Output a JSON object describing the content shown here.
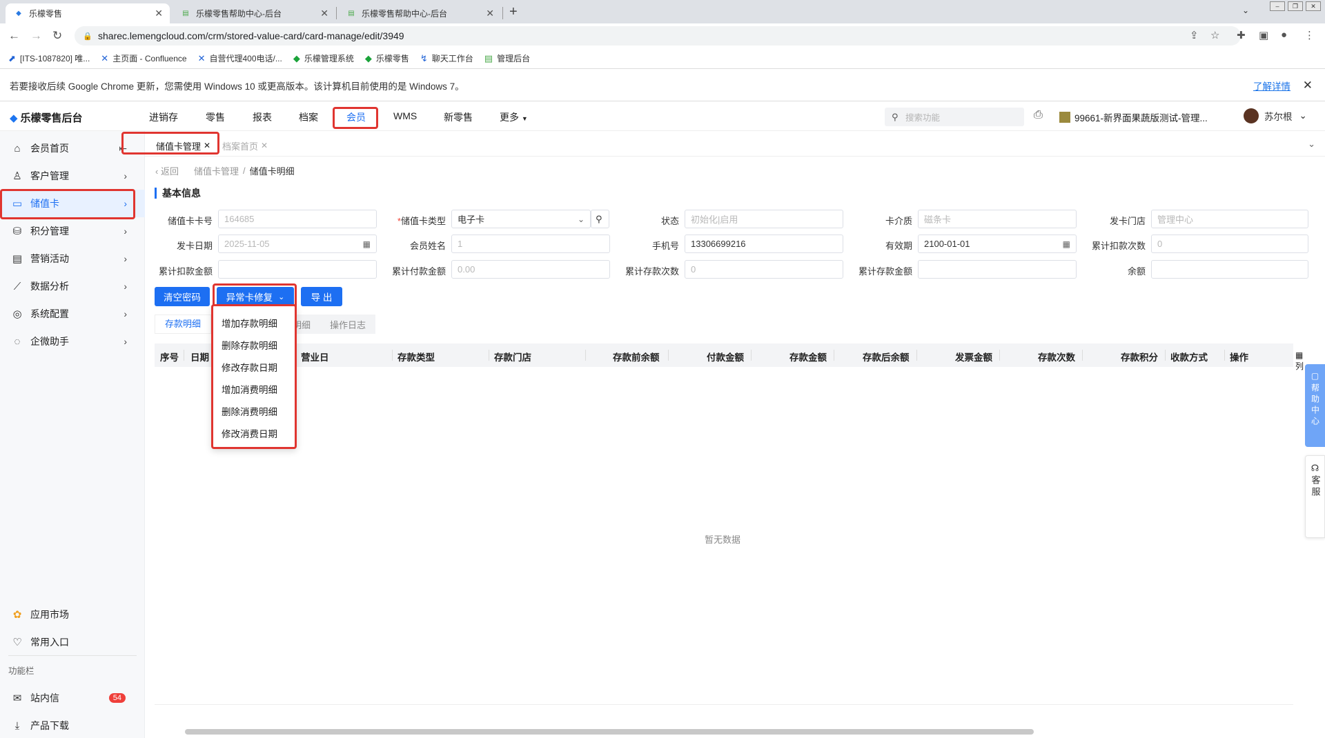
{
  "browser": {
    "tabs": [
      {
        "label": "乐檬零售"
      },
      {
        "label": "乐檬零售帮助中心-后台"
      },
      {
        "label": "乐檬零售帮助中心-后台"
      }
    ],
    "url": "sharec.lemengcloud.com/crm/stored-value-card/card-manage/edit/3949",
    "bookmarks": [
      "[ITS-1087820] 唯...",
      "主页面 - Confluence",
      "自营代理400电话/...",
      "乐檬管理系统",
      "乐檬零售",
      "聊天工作台",
      "管理后台"
    ],
    "infobar_text": "若要接收后续 Google Chrome 更新，您需使用 Windows 10 或更高版本。该计算机目前使用的是 Windows 7。",
    "infobar_link": "了解详情"
  },
  "app": {
    "logo": "乐檬零售后台",
    "menu": [
      "进销存",
      "零售",
      "报表",
      "档案",
      "会员",
      "WMS",
      "新零售",
      "更多"
    ],
    "search_placeholder": "搜索功能",
    "store": "99661-新界面果蔬版测试-管理...",
    "user": "苏尔根"
  },
  "sidebar": {
    "items": [
      {
        "label": "会员首页",
        "icon": "home-icon"
      },
      {
        "label": "客户管理",
        "icon": "user-icon"
      },
      {
        "label": "储值卡",
        "icon": "card-icon"
      },
      {
        "label": "积分管理",
        "icon": "coins-icon"
      },
      {
        "label": "营销活动",
        "icon": "calendar-icon"
      },
      {
        "label": "数据分析",
        "icon": "chart-icon"
      },
      {
        "label": "系统配置",
        "icon": "settings-icon"
      },
      {
        "label": "企微助手",
        "icon": "chat-icon"
      }
    ],
    "bottom": [
      {
        "label": "应用市场"
      },
      {
        "label": "常用入口"
      }
    ],
    "section_title": "功能栏",
    "inbox": "站内信",
    "inbox_count": "54",
    "download": "产品下载"
  },
  "page_tabs": [
    "储值卡管理",
    "档案首页"
  ],
  "breadcrumb": {
    "back": "返回",
    "parent": "储值卡管理",
    "current": "储值卡明细"
  },
  "section_title": "基本信息",
  "form": {
    "card_no": {
      "label": "储值卡卡号",
      "value": "164685"
    },
    "card_type": {
      "label": "储值卡类型",
      "value": "电子卡"
    },
    "status": {
      "label": "状态",
      "value": "初始化|启用"
    },
    "medium": {
      "label": "卡介质",
      "value": "磁条卡"
    },
    "issue_store": {
      "label": "发卡门店",
      "value": "管理中心"
    },
    "issue_date": {
      "label": "发卡日期",
      "value": "2025-11-05"
    },
    "member_name": {
      "label": "会员姓名",
      "value": "1"
    },
    "phone": {
      "label": "手机号",
      "value": "13306699216"
    },
    "expiry": {
      "label": "有效期",
      "value": "2100-01-01"
    },
    "deduct_count": {
      "label": "累计扣款次数",
      "value": "0"
    },
    "deduct_amount": {
      "label": "累计扣款金额",
      "value": ""
    },
    "pay_amount": {
      "label": "累计付款金额",
      "value": "0.00"
    },
    "deposit_count": {
      "label": "累计存款次数",
      "value": "0"
    },
    "deposit_amount": {
      "label": "累计存款金额",
      "value": ""
    },
    "balance": {
      "label": "余额",
      "value": ""
    }
  },
  "buttons": {
    "clear_pwd": "清空密码",
    "repair": "异常卡修复",
    "export": "导 出"
  },
  "dropdown": [
    "增加存款明细",
    "删除存款明细",
    "修改存款日期",
    "增加消费明细",
    "删除消费明细",
    "修改消费日期"
  ],
  "subtabs": [
    "存款明细",
    "明细",
    "操作日志"
  ],
  "table": {
    "columns": [
      "序号",
      "日期",
      "营业日",
      "存款类型",
      "存款门店",
      "存款前余额",
      "付款金额",
      "存款金额",
      "存款后余额",
      "发票金额",
      "存款次数",
      "存款积分",
      "收款方式",
      "操作"
    ],
    "empty_text": "暂无数据",
    "col_icon": "列"
  },
  "float": {
    "help": "帮助中心",
    "service": "客服"
  }
}
